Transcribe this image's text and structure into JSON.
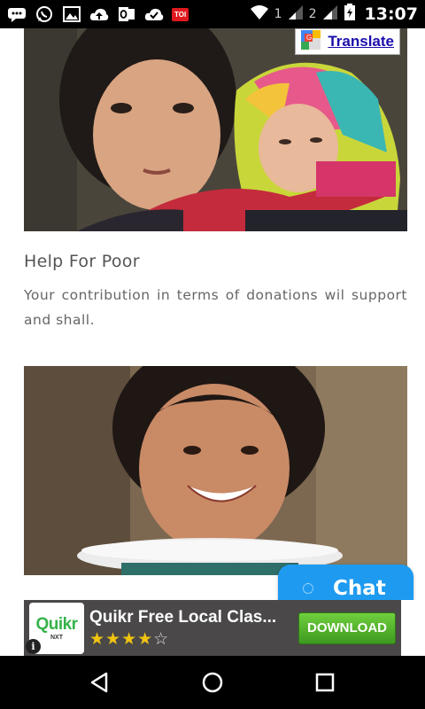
{
  "status_bar": {
    "sim1": "1",
    "sim2": "2",
    "time": "13:07",
    "toi_label": "TOI",
    "icons": [
      "messages-icon",
      "whatsapp-icon",
      "gallery-icon",
      "cloud-upload-icon",
      "outlook-icon",
      "checkmark-cloud-icon",
      "toi-icon",
      "wifi-icon",
      "signal-icon",
      "signal-icon",
      "battery-icon"
    ]
  },
  "translate": {
    "label": "Translate"
  },
  "card": {
    "title": "Help For Poor",
    "text": "Your contribution in terms of donations wil support and shall."
  },
  "chat": {
    "label": "Chat",
    "color": "#1e9bf0"
  },
  "ad": {
    "logo_text": "Quikr",
    "logo_sub": "NXT",
    "title": "Quikr Free Local Clas...",
    "stars": "★★★★",
    "empty_star": "☆",
    "rating": 4,
    "download_label": "DOWNLOAD",
    "info": "i"
  },
  "nav": {
    "icons": [
      "back-icon",
      "home-icon",
      "recents-icon"
    ]
  }
}
